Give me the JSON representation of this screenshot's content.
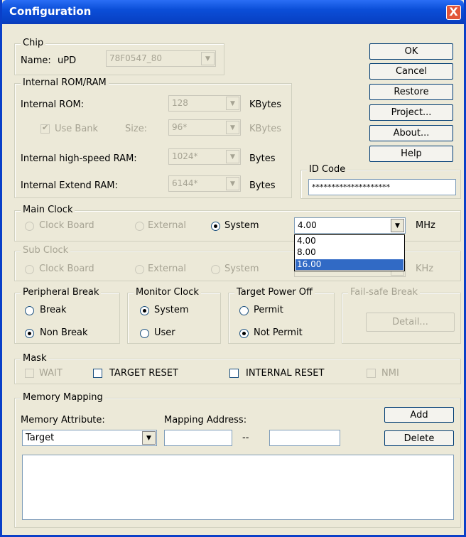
{
  "window": {
    "title": "Configuration",
    "close_glyph": "X"
  },
  "chip": {
    "legend": "Chip",
    "name_label": "Name:",
    "name_value": "uPD",
    "chip_select": "78F0547_80"
  },
  "internal": {
    "legend": "Internal ROM/RAM",
    "rom_label": "Internal ROM:",
    "rom_value": "128",
    "rom_unit": "KBytes",
    "use_bank_label": "Use Bank",
    "size_label": "Size:",
    "size_value": "96*",
    "size_unit": "KBytes",
    "hsram_label": "Internal high-speed RAM:",
    "hsram_value": "1024*",
    "hsram_unit": "Bytes",
    "extram_label": "Internal Extend RAM:",
    "extram_value": "6144*",
    "extram_unit": "Bytes"
  },
  "buttons": {
    "ok": "OK",
    "cancel": "Cancel",
    "restore": "Restore",
    "project": "Project...",
    "about": "About...",
    "help": "Help"
  },
  "id_code": {
    "legend": "ID Code",
    "value": "********************"
  },
  "main_clock": {
    "legend": "Main Clock",
    "opt_board": "Clock Board",
    "opt_external": "External",
    "opt_system": "System",
    "value": "4.00",
    "unit": "MHz",
    "options": [
      "4.00",
      "8.00",
      "16.00"
    ]
  },
  "sub_clock": {
    "legend": "Sub Clock",
    "opt_board": "Clock Board",
    "opt_external": "External",
    "opt_system": "System",
    "unit": "KHz"
  },
  "peripheral_break": {
    "legend": "Peripheral Break",
    "opt_break": "Break",
    "opt_nonbreak": "Non Break"
  },
  "monitor_clock": {
    "legend": "Monitor Clock",
    "opt_system": "System",
    "opt_user": "User"
  },
  "target_power": {
    "legend": "Target Power Off",
    "opt_permit": "Permit",
    "opt_notpermit": "Not Permit"
  },
  "failsafe": {
    "legend": "Fail-safe Break",
    "detail": "Detail..."
  },
  "mask": {
    "legend": "Mask",
    "wait": "WAIT",
    "target_reset": "TARGET RESET",
    "internal_reset": "INTERNAL RESET",
    "nmi": "NMI"
  },
  "memory_mapping": {
    "legend": "Memory Mapping",
    "attr_label": "Memory Attribute:",
    "attr_value": "Target",
    "addr_label": "Mapping Address:",
    "addr_sep": "--",
    "add": "Add",
    "delete": "Delete"
  }
}
